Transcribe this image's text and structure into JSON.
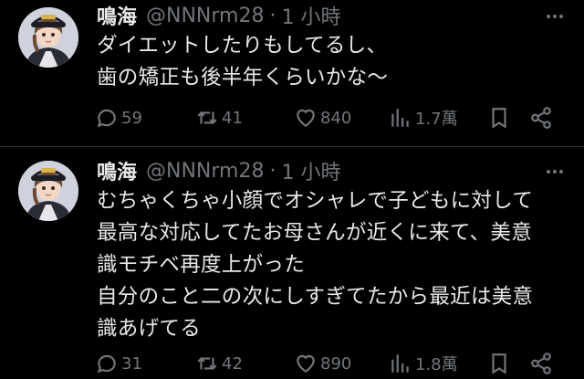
{
  "tweets": [
    {
      "name": "鳴海",
      "handle": "@NNNrm28",
      "separator": "·",
      "time": "1 小時",
      "text": "ダイエットしたりもしてるし、\n歯の矯正も後半年くらいかな〜",
      "replies": "59",
      "retweets": "41",
      "likes": "840",
      "views": "1.7萬"
    },
    {
      "name": "鳴海",
      "handle": "@NNNrm28",
      "separator": "·",
      "time": "1 小時",
      "text": "むちゃくちゃ小顔でオシャレで子どもに対して\n最高な対応してたお母さんが近くに来て、美意\n識モチベ再度上がった\n自分のこと二の次にしすぎてたから最近は美意\n識あげてる",
      "replies": "31",
      "retweets": "42",
      "likes": "890",
      "views": "1.8萬"
    }
  ],
  "icons": {
    "more": "more-horizontal-icon",
    "reply": "reply-icon",
    "retweet": "retweet-icon",
    "like": "heart-icon",
    "views": "views-chart-icon",
    "bookmark": "bookmark-icon",
    "share": "share-icon"
  },
  "colors": {
    "background": "#000000",
    "text": "#e7e9ea",
    "secondary": "#71767b",
    "divider": "#2f3336"
  }
}
